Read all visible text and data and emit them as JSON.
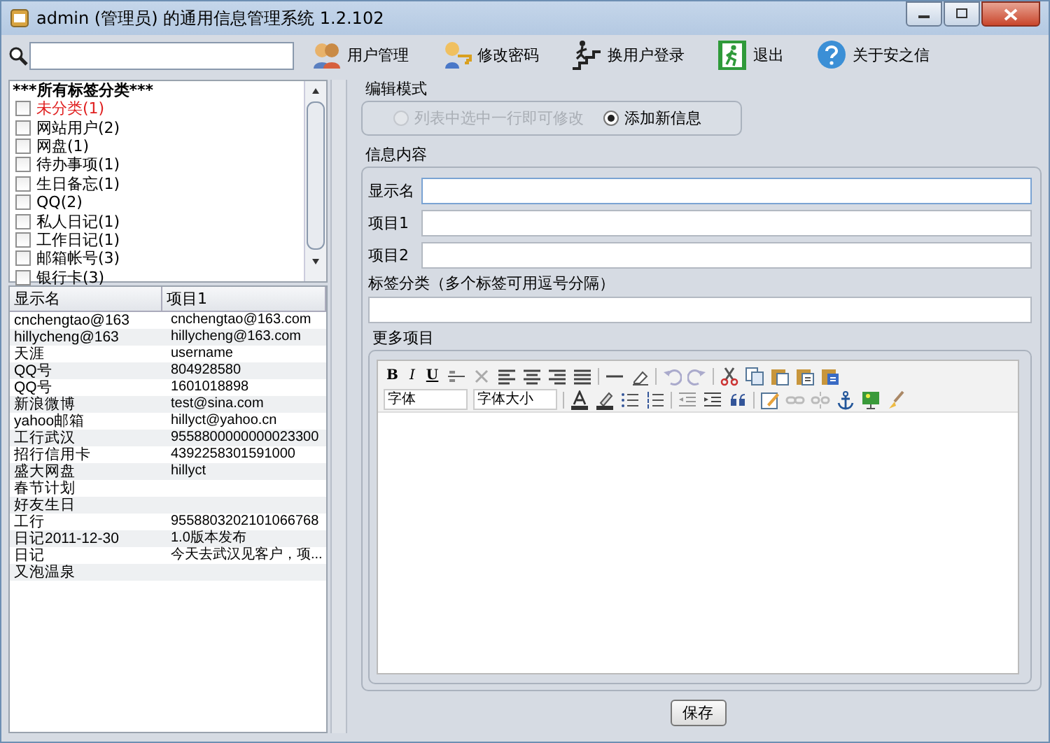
{
  "window": {
    "title": "admin (管理员) 的通用信息管理系统 1.2.102"
  },
  "toolbar": {
    "buttons": [
      {
        "label": "用户管理",
        "kind": "users"
      },
      {
        "label": "修改密码",
        "kind": "key"
      },
      {
        "label": "换用户登录",
        "kind": "climb"
      },
      {
        "label": "退出",
        "kind": "exit"
      },
      {
        "label": "关于安之信",
        "kind": "help"
      }
    ]
  },
  "tags": {
    "header": "***所有标签分类***",
    "items": [
      {
        "label": "未分类(1)",
        "checked": false,
        "highlight": true
      },
      {
        "label": "网站用户(2)",
        "checked": false,
        "highlight": false
      },
      {
        "label": "网盘(1)",
        "checked": false,
        "highlight": false
      },
      {
        "label": "待办事项(1)",
        "checked": false,
        "highlight": false
      },
      {
        "label": "生日备忘(1)",
        "checked": false,
        "highlight": false
      },
      {
        "label": "QQ(2)",
        "checked": false,
        "highlight": false
      },
      {
        "label": "私人日记(1)",
        "checked": false,
        "highlight": false
      },
      {
        "label": "工作日记(1)",
        "checked": false,
        "highlight": false
      },
      {
        "label": "邮箱帐号(3)",
        "checked": false,
        "highlight": false
      },
      {
        "label": "银行卡(3)",
        "checked": false,
        "highlight": false
      }
    ]
  },
  "table": {
    "columns": [
      "显示名",
      "项目1"
    ],
    "rows": [
      [
        "cnchengtao@163",
        "cnchengtao@163.com"
      ],
      [
        "hillycheng@163",
        "hillycheng@163.com"
      ],
      [
        "天涯",
        "username"
      ],
      [
        "QQ号",
        "804928580"
      ],
      [
        "QQ号",
        "1601018898"
      ],
      [
        "新浪微博",
        "test@sina.com"
      ],
      [
        "yahoo邮箱",
        "hillyct@yahoo.cn"
      ],
      [
        "工行武汉",
        "9558800000000023300"
      ],
      [
        "招行信用卡",
        "4392258301591000"
      ],
      [
        "盛大网盘",
        "hillyct"
      ],
      [
        "春节计划",
        ""
      ],
      [
        "好友生日",
        ""
      ],
      [
        "工行",
        "9558803202101066768"
      ],
      [
        "日记2011-12-30",
        "1.0版本发布"
      ],
      [
        "日记",
        "今天去武汉见客户，项..."
      ],
      [
        "又泡温泉",
        ""
      ]
    ]
  },
  "edit_mode": {
    "title": "编辑模式",
    "options": [
      {
        "label": "列表中选中一行即可修改",
        "selected": false,
        "disabled": true
      },
      {
        "label": "添加新信息",
        "selected": true,
        "disabled": false
      }
    ]
  },
  "info": {
    "title": "信息内容",
    "fields": [
      {
        "label": "显示名",
        "focused": true
      },
      {
        "label": "项目1",
        "focused": false
      },
      {
        "label": "项目2",
        "focused": false
      }
    ],
    "tags_field": {
      "label": "标签分类（多个标签可用逗号分隔）"
    },
    "more": {
      "title": "更多项目",
      "format_buttons": [
        "B",
        "I",
        "U"
      ],
      "font_select": "字体",
      "size_select": "字体大小"
    }
  },
  "save_button": "保存"
}
